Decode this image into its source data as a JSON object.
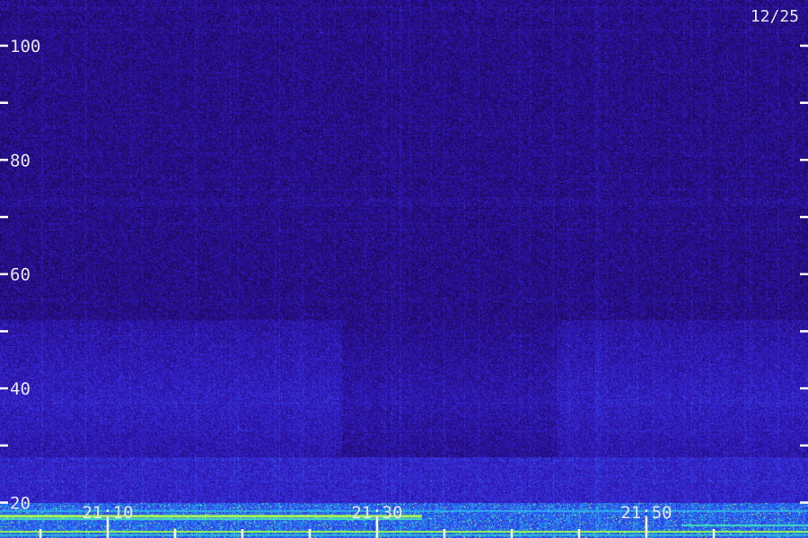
{
  "chart_data": {
    "type": "heatmap",
    "title": "",
    "xlabel": "",
    "ylabel": "",
    "date_label": "12/25",
    "y_axis": {
      "range": [
        13.8,
        108
      ],
      "major_ticks": [
        20,
        40,
        60,
        80,
        100
      ],
      "minor_ticks": [
        30,
        50,
        70,
        90
      ],
      "tick_labels": [
        "20",
        "40",
        "60",
        "80",
        "100"
      ],
      "ticks_on_right_edge": true
    },
    "x_axis": {
      "range": [
        "21:02",
        "21:62"
      ],
      "labeled_ticks": [
        "21:10",
        "21:30",
        "21:50"
      ],
      "tick_labels": [
        "21:10",
        "21:30",
        "21:50"
      ],
      "tick_minutes": [
        5,
        10,
        15,
        20,
        25,
        30,
        35,
        40,
        45,
        50,
        55
      ],
      "major_tick_minutes": [
        10,
        30,
        50
      ]
    },
    "colormap": [
      "#1a0640",
      "#2a10a0",
      "#3a30e0",
      "#2080ff",
      "#20e0c0",
      "#c0ff40"
    ],
    "intensity_profile": {
      "note_levels": "relative intensity 0-1 by frequency band",
      "background": 0.15,
      "band_30_50": 0.3,
      "band_below_20": 0.8
    }
  }
}
